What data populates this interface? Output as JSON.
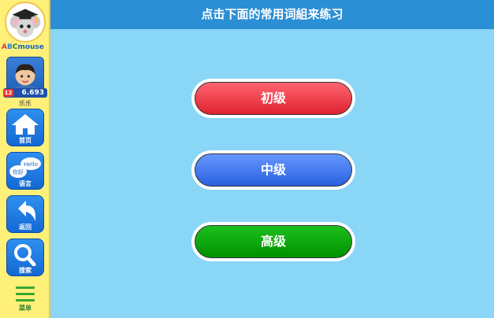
{
  "sidebar": {
    "brand": {
      "a": "A",
      "b": "B",
      "c": "C",
      "rest": "mouse"
    },
    "user": {
      "points": "6.693",
      "badge": "12",
      "name": "乐乐"
    },
    "nav": [
      {
        "label": "首页",
        "icon": "home-icon"
      },
      {
        "label": "语言",
        "icon": "speech-bubbles-icon"
      },
      {
        "label": "返回",
        "icon": "back-arrow-icon"
      },
      {
        "label": "搜索",
        "icon": "search-icon"
      }
    ],
    "menu_label": "菜单",
    "speech_text": {
      "hello": "Hello",
      "nihao": "你好"
    }
  },
  "header": {
    "title": "点击下面的常用词組来练习"
  },
  "levels": [
    {
      "label": "初级",
      "color": "#e53040"
    },
    {
      "label": "中级",
      "color": "#3d74ea"
    },
    {
      "label": "高级",
      "color": "#07a507"
    }
  ],
  "colors": {
    "background": "#8ad6f6",
    "header": "#2b8fd6",
    "sidebar": "#fff07a"
  }
}
